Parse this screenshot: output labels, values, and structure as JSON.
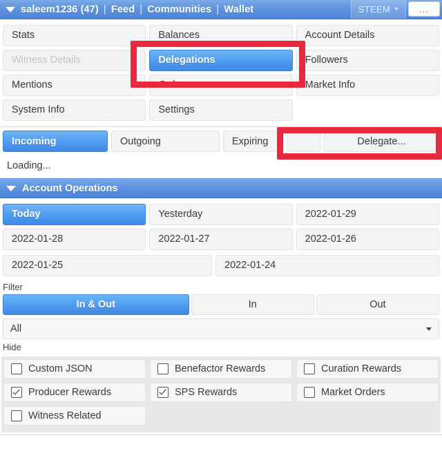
{
  "topbar": {
    "caret_icon": "triangle-down-icon",
    "account": "saleem1236 (47)",
    "sep": "|",
    "link_feed": "Feed",
    "link_communities": "Communities",
    "link_wallet": "Wallet",
    "currency": "STEEM",
    "currency_caret_icon": "triangle-down-icon",
    "more_label": "...",
    "bar_color": "#5289db"
  },
  "nav": {
    "col1": [
      {
        "label": "Stats",
        "state": "normal"
      },
      {
        "label": "Witness Details",
        "state": "disabled"
      },
      {
        "label": "Mentions",
        "state": "normal"
      },
      {
        "label": "System Info",
        "state": "normal"
      }
    ],
    "col2": [
      {
        "label": "Balances",
        "state": "normal"
      },
      {
        "label": "Delegations",
        "state": "active"
      },
      {
        "label": "Orders",
        "state": "normal"
      },
      {
        "label": "Settings",
        "state": "normal"
      }
    ],
    "col3": [
      {
        "label": "Account Details",
        "state": "normal"
      },
      {
        "label": "Followers",
        "state": "normal"
      },
      {
        "label": "Market Info",
        "state": "normal"
      }
    ]
  },
  "delegations": {
    "tabs": [
      {
        "label": "Incoming",
        "state": "active"
      },
      {
        "label": "Outgoing",
        "state": "normal"
      },
      {
        "label": "Expiring",
        "state": "normal"
      }
    ],
    "blank_button_label": "",
    "delegate_button_label": "Delegate...",
    "status": "Loading..."
  },
  "account_operations": {
    "caret_icon": "triangle-down-icon",
    "title": "Account Operations",
    "dates": [
      {
        "label": "Today",
        "state": "active"
      },
      {
        "label": "Yesterday",
        "state": "normal"
      },
      {
        "label": "2022-01-29",
        "state": "normal"
      },
      {
        "label": "2022-01-28",
        "state": "normal"
      },
      {
        "label": "2022-01-27",
        "state": "normal"
      },
      {
        "label": "2022-01-26",
        "state": "normal"
      },
      {
        "label": "2022-01-25",
        "state": "normal"
      },
      {
        "label": "2022-01-24",
        "state": "normal"
      }
    ]
  },
  "filter": {
    "label": "Filter",
    "segments": [
      {
        "label": "In & Out",
        "state": "active"
      },
      {
        "label": "In",
        "state": "normal"
      },
      {
        "label": "Out",
        "state": "normal"
      }
    ],
    "select_value": "All",
    "select_caret_icon": "caret-down-icon"
  },
  "hide": {
    "label": "Hide",
    "items": [
      {
        "label": "Custom JSON",
        "checked": false
      },
      {
        "label": "Benefactor Rewards",
        "checked": false
      },
      {
        "label": "Curation Rewards",
        "checked": false
      },
      {
        "label": "Producer Rewards",
        "checked": true
      },
      {
        "label": "SPS Rewards",
        "checked": true
      },
      {
        "label": "Market Orders",
        "checked": false
      },
      {
        "label": "Witness Related",
        "checked": false
      }
    ]
  },
  "annotations": {
    "highlight_color": "#e8283c",
    "boxes": [
      {
        "name": "delegations-highlight"
      },
      {
        "name": "delegate-button-highlight"
      }
    ]
  }
}
